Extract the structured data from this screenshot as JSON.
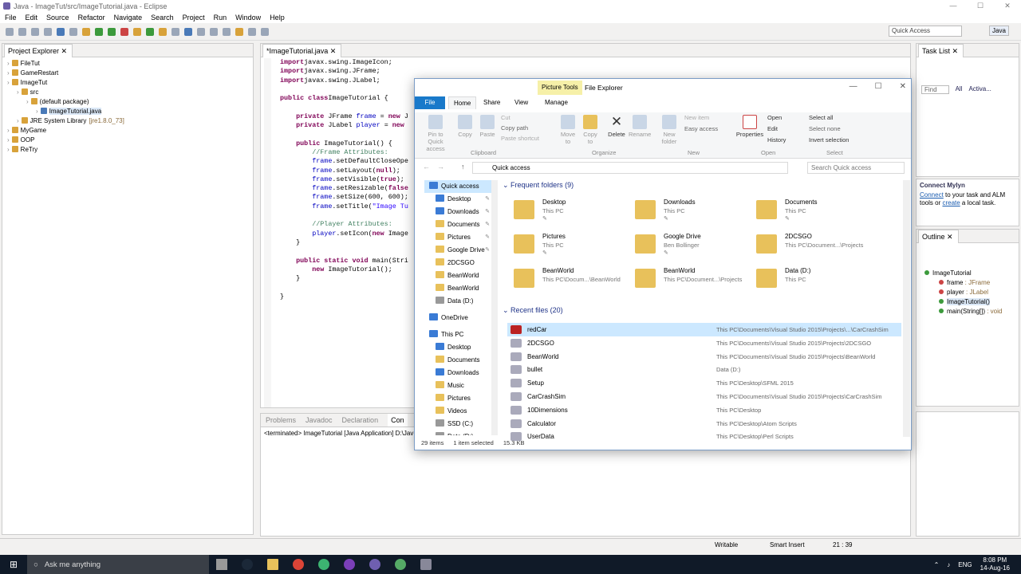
{
  "window": {
    "title": "Java - ImageTut/src/ImageTutorial.java - Eclipse",
    "controls": [
      "—",
      "☐",
      "✕"
    ]
  },
  "menu": [
    "File",
    "Edit",
    "Source",
    "Refactor",
    "Navigate",
    "Search",
    "Project",
    "Run",
    "Window",
    "Help"
  ],
  "toolbar": {
    "quick_access": "Quick Access",
    "perspective": "Java"
  },
  "project_explorer": {
    "title": "Project Explorer",
    "items": [
      {
        "label": "FileTut",
        "indent": 0
      },
      {
        "label": "GameRestart",
        "indent": 0
      },
      {
        "label": "ImageTut",
        "indent": 0
      },
      {
        "label": "src",
        "indent": 1
      },
      {
        "label": "(default package)",
        "indent": 2
      },
      {
        "label": "ImageTutorial.java",
        "indent": 3,
        "selected": true
      },
      {
        "label": "JRE System Library",
        "extra": "[jre1.8.0_73]",
        "indent": 1
      },
      {
        "label": "MyGame",
        "indent": 0
      },
      {
        "label": "OOP",
        "indent": 0
      },
      {
        "label": "ReTry",
        "indent": 0
      }
    ]
  },
  "editor": {
    "tab": "*ImageTutorial.java",
    "lines": [
      [
        [
          "kw",
          "import"
        ],
        [
          "",
          "javax.swing.ImageIcon;"
        ]
      ],
      [
        [
          "kw",
          "import"
        ],
        [
          "",
          "javax.swing.JFrame;"
        ]
      ],
      [
        [
          "kw",
          "import"
        ],
        [
          "",
          "javax.swing.JLabel;"
        ]
      ],
      [],
      [
        [
          "kw",
          "public class"
        ],
        [
          "",
          "ImageTutorial {"
        ]
      ],
      [],
      [
        [
          "",
          "    "
        ],
        [
          "kw",
          "private"
        ],
        [
          "",
          " JFrame "
        ],
        [
          "fd",
          "frame"
        ],
        [
          "",
          " = "
        ],
        [
          "kw",
          "new"
        ],
        [
          "",
          " J"
        ]
      ],
      [
        [
          "",
          "    "
        ],
        [
          "kw",
          "private"
        ],
        [
          "",
          " JLabel "
        ],
        [
          "fd",
          "player"
        ],
        [
          "",
          " = "
        ],
        [
          "kw",
          "new"
        ]
      ],
      [],
      [
        [
          "",
          "    "
        ],
        [
          "kw",
          "public"
        ],
        [
          "",
          " ImageTutorial() {"
        ]
      ],
      [
        [
          "",
          "        "
        ],
        [
          "cm",
          "//Frame Attributes:"
        ]
      ],
      [
        [
          "",
          "        "
        ],
        [
          "fd",
          "frame"
        ],
        [
          "",
          ".setDefaultCloseOpe"
        ]
      ],
      [
        [
          "",
          "        "
        ],
        [
          "fd",
          "frame"
        ],
        [
          "",
          ".setLayout("
        ],
        [
          "kw",
          "null"
        ],
        [
          "",
          ");"
        ]
      ],
      [
        [
          "",
          "        "
        ],
        [
          "fd",
          "frame"
        ],
        [
          "",
          ".setVisible("
        ],
        [
          "kw",
          "true"
        ],
        [
          "",
          ");"
        ]
      ],
      [
        [
          "",
          "        "
        ],
        [
          "fd",
          "frame"
        ],
        [
          "",
          ".setResizable("
        ],
        [
          "kw",
          "false"
        ]
      ],
      [
        [
          "",
          "        "
        ],
        [
          "fd",
          "frame"
        ],
        [
          "",
          ".setSize(600, 600);"
        ]
      ],
      [
        [
          "",
          "        "
        ],
        [
          "fd",
          "frame"
        ],
        [
          "",
          ".setTitle("
        ],
        [
          "st",
          "\"Image Tu"
        ]
      ],
      [],
      [
        [
          "",
          "        "
        ],
        [
          "cm",
          "//Player Attributes:"
        ]
      ],
      [
        [
          "",
          "        "
        ],
        [
          "fd",
          "player"
        ],
        [
          "",
          ".setIcon("
        ],
        [
          "kw",
          "new"
        ],
        [
          "",
          " Image"
        ]
      ],
      [
        [
          "",
          "    }"
        ]
      ],
      [],
      [
        [
          "",
          "    "
        ],
        [
          "kw",
          "public static void"
        ],
        [
          "",
          " main(Stri"
        ]
      ],
      [
        [
          "",
          "        "
        ],
        [
          "kw",
          "new"
        ],
        [
          "",
          " ImageTutorial();"
        ]
      ],
      [
        [
          "",
          "    }"
        ]
      ],
      [],
      [
        [
          "",
          "}"
        ]
      ]
    ]
  },
  "console": {
    "tabs": [
      "Problems",
      "Javadoc",
      "Declaration",
      "Con"
    ],
    "line": "<terminated> ImageTutorial [Java Application] D:\\Jav"
  },
  "status": {
    "writable": "Writable",
    "insert": "Smart Insert",
    "pos": "21 : 39"
  },
  "task_list": {
    "title": "Task List",
    "find": "Find",
    "all": "All",
    "activate": "Activa..."
  },
  "mylyn": {
    "title": "Connect Mylyn",
    "text1": "Connect",
    "text2": " to your task and ALM tools or ",
    "text3": "create",
    "text4": " a local task."
  },
  "outline": {
    "title": "Outline",
    "items": [
      {
        "label": "ImageTutorial",
        "indent": 0,
        "extra": ""
      },
      {
        "label": "frame",
        "extra": " : JFrame",
        "indent": 1
      },
      {
        "label": "player",
        "extra": " : JLabel",
        "indent": 1
      },
      {
        "label": "ImageTutorial()",
        "extra": "",
        "indent": 1,
        "selected": true
      },
      {
        "label": "main(String[])",
        "extra": " : void",
        "indent": 1
      }
    ]
  },
  "explorer": {
    "title": "File Explorer",
    "context_tab": "Picture Tools",
    "file_tab": "File",
    "tabs": [
      "Home",
      "Share",
      "View",
      "Manage"
    ],
    "ribbon": {
      "pin": "Pin to Quick access",
      "copy": "Copy",
      "paste": "Paste",
      "cut": "Cut",
      "copy_path": "Copy path",
      "paste_shortcut": "Paste shortcut",
      "move_to": "Move to",
      "copy_to": "Copy to",
      "delete": "Delete",
      "rename": "Rename",
      "new_folder": "New folder",
      "new_item": "New item",
      "easy_access": "Easy access",
      "properties": "Properties",
      "open": "Open",
      "edit": "Edit",
      "history": "History",
      "select_all": "Select all",
      "select_none": "Select none",
      "invert": "Invert selection",
      "groups": [
        "Clipboard",
        "Organize",
        "New",
        "Open",
        "Select"
      ]
    },
    "address": "Quick access",
    "search_placeholder": "Search Quick access",
    "nav": [
      {
        "label": "Quick access",
        "type": "blue",
        "pin": false,
        "sel": true
      },
      {
        "label": "Desktop",
        "type": "blue",
        "pin": true
      },
      {
        "label": "Downloads",
        "type": "blue",
        "pin": true
      },
      {
        "label": "Documents",
        "type": "",
        "pin": true
      },
      {
        "label": "Pictures",
        "type": "",
        "pin": true
      },
      {
        "label": "Google Drive",
        "type": "",
        "pin": true
      },
      {
        "label": "2DCSGO",
        "type": "",
        "pin": false
      },
      {
        "label": "BeanWorld",
        "type": "",
        "pin": false
      },
      {
        "label": "BeanWorld",
        "type": "",
        "pin": false
      },
      {
        "label": "Data (D:)",
        "type": "drive",
        "pin": false
      },
      {
        "label": "",
        "type": "gap"
      },
      {
        "label": "OneDrive",
        "type": "blue",
        "pin": false
      },
      {
        "label": "",
        "type": "gap"
      },
      {
        "label": "This PC",
        "type": "blue",
        "pin": false
      },
      {
        "label": "Desktop",
        "type": "blue",
        "pin": false
      },
      {
        "label": "Documents",
        "type": "",
        "pin": false
      },
      {
        "label": "Downloads",
        "type": "blue",
        "pin": false
      },
      {
        "label": "Music",
        "type": "",
        "pin": false
      },
      {
        "label": "Pictures",
        "type": "",
        "pin": false
      },
      {
        "label": "Videos",
        "type": "",
        "pin": false
      },
      {
        "label": "SSD (C:)",
        "type": "drive",
        "pin": false
      },
      {
        "label": "Data (D:)",
        "type": "drive",
        "pin": false
      }
    ],
    "frequent_title": "Frequent folders (9)",
    "frequent": [
      {
        "name": "Desktop",
        "sub": "This PC",
        "pin": true
      },
      {
        "name": "Downloads",
        "sub": "This PC",
        "pin": true
      },
      {
        "name": "Documents",
        "sub": "This PC",
        "pin": true
      },
      {
        "name": "Pictures",
        "sub": "This PC",
        "pin": true
      },
      {
        "name": "Google Drive",
        "sub": "Ben Bollinger",
        "pin": true
      },
      {
        "name": "2DCSGO",
        "sub": "This PC\\Document...\\Projects",
        "pin": false
      },
      {
        "name": "BeanWorld",
        "sub": "This PC\\Docum...\\BeanWorld",
        "pin": false
      },
      {
        "name": "BeanWorld",
        "sub": "This PC\\Document...\\Projects",
        "pin": false
      },
      {
        "name": "Data (D:)",
        "sub": "This PC",
        "pin": false
      }
    ],
    "recent_title": "Recent files (20)",
    "recent": [
      {
        "name": "redCar",
        "path": "This PC\\Documents\\Visual Studio 2015\\Projects\\...\\CarCrashSim",
        "sel": true
      },
      {
        "name": "2DCSGO",
        "path": "This PC\\Documents\\Visual Studio 2015\\Projects\\2DCSGO"
      },
      {
        "name": "BeanWorld",
        "path": "This PC\\Documents\\Visual Studio 2015\\Projects\\BeanWorld"
      },
      {
        "name": "bullet",
        "path": "Data (D:)"
      },
      {
        "name": "Setup",
        "path": "This PC\\Desktop\\SFML 2015"
      },
      {
        "name": "CarCrashSim",
        "path": "This PC\\Documents\\Visual Studio 2015\\Projects\\CarCrashSim"
      },
      {
        "name": "10Dimensions",
        "path": "This PC\\Desktop"
      },
      {
        "name": "Calculator",
        "path": "This PC\\Desktop\\Atom Scripts"
      },
      {
        "name": "UserData",
        "path": "This PC\\Desktop\\Perl Scripts"
      }
    ],
    "status": {
      "items": "29 items",
      "selected": "1 item selected",
      "size": "15.3 KB"
    }
  },
  "taskbar": {
    "search": "Ask me anything",
    "time": "8:08 PM",
    "date": "14-Aug-16",
    "lang": "ENG"
  }
}
